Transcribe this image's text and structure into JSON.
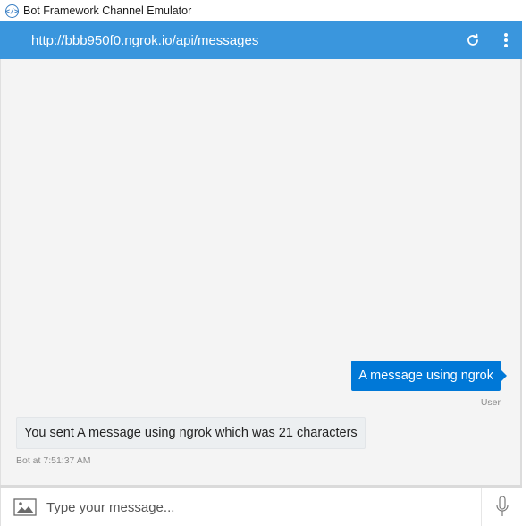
{
  "window": {
    "title": "Bot Framework Channel Emulator",
    "icon": "bot-framework-icon"
  },
  "header": {
    "url": "http://bbb950f0.ngrok.io/api/messages",
    "refresh_icon": "refresh-icon",
    "menu_icon": "more-vertical-icon",
    "background": "#3a96dd"
  },
  "messages": [
    {
      "from": "user",
      "text": "A message using ngrok",
      "label": "User",
      "color": "#0078d7"
    },
    {
      "from": "bot",
      "text": "You sent A message using ngrok which was 21 characters",
      "label": "Bot at 7:51:37 AM"
    }
  ],
  "composer": {
    "placeholder": "Type your message...",
    "value": "",
    "image_icon": "image-upload-icon",
    "mic_icon": "microphone-icon"
  }
}
